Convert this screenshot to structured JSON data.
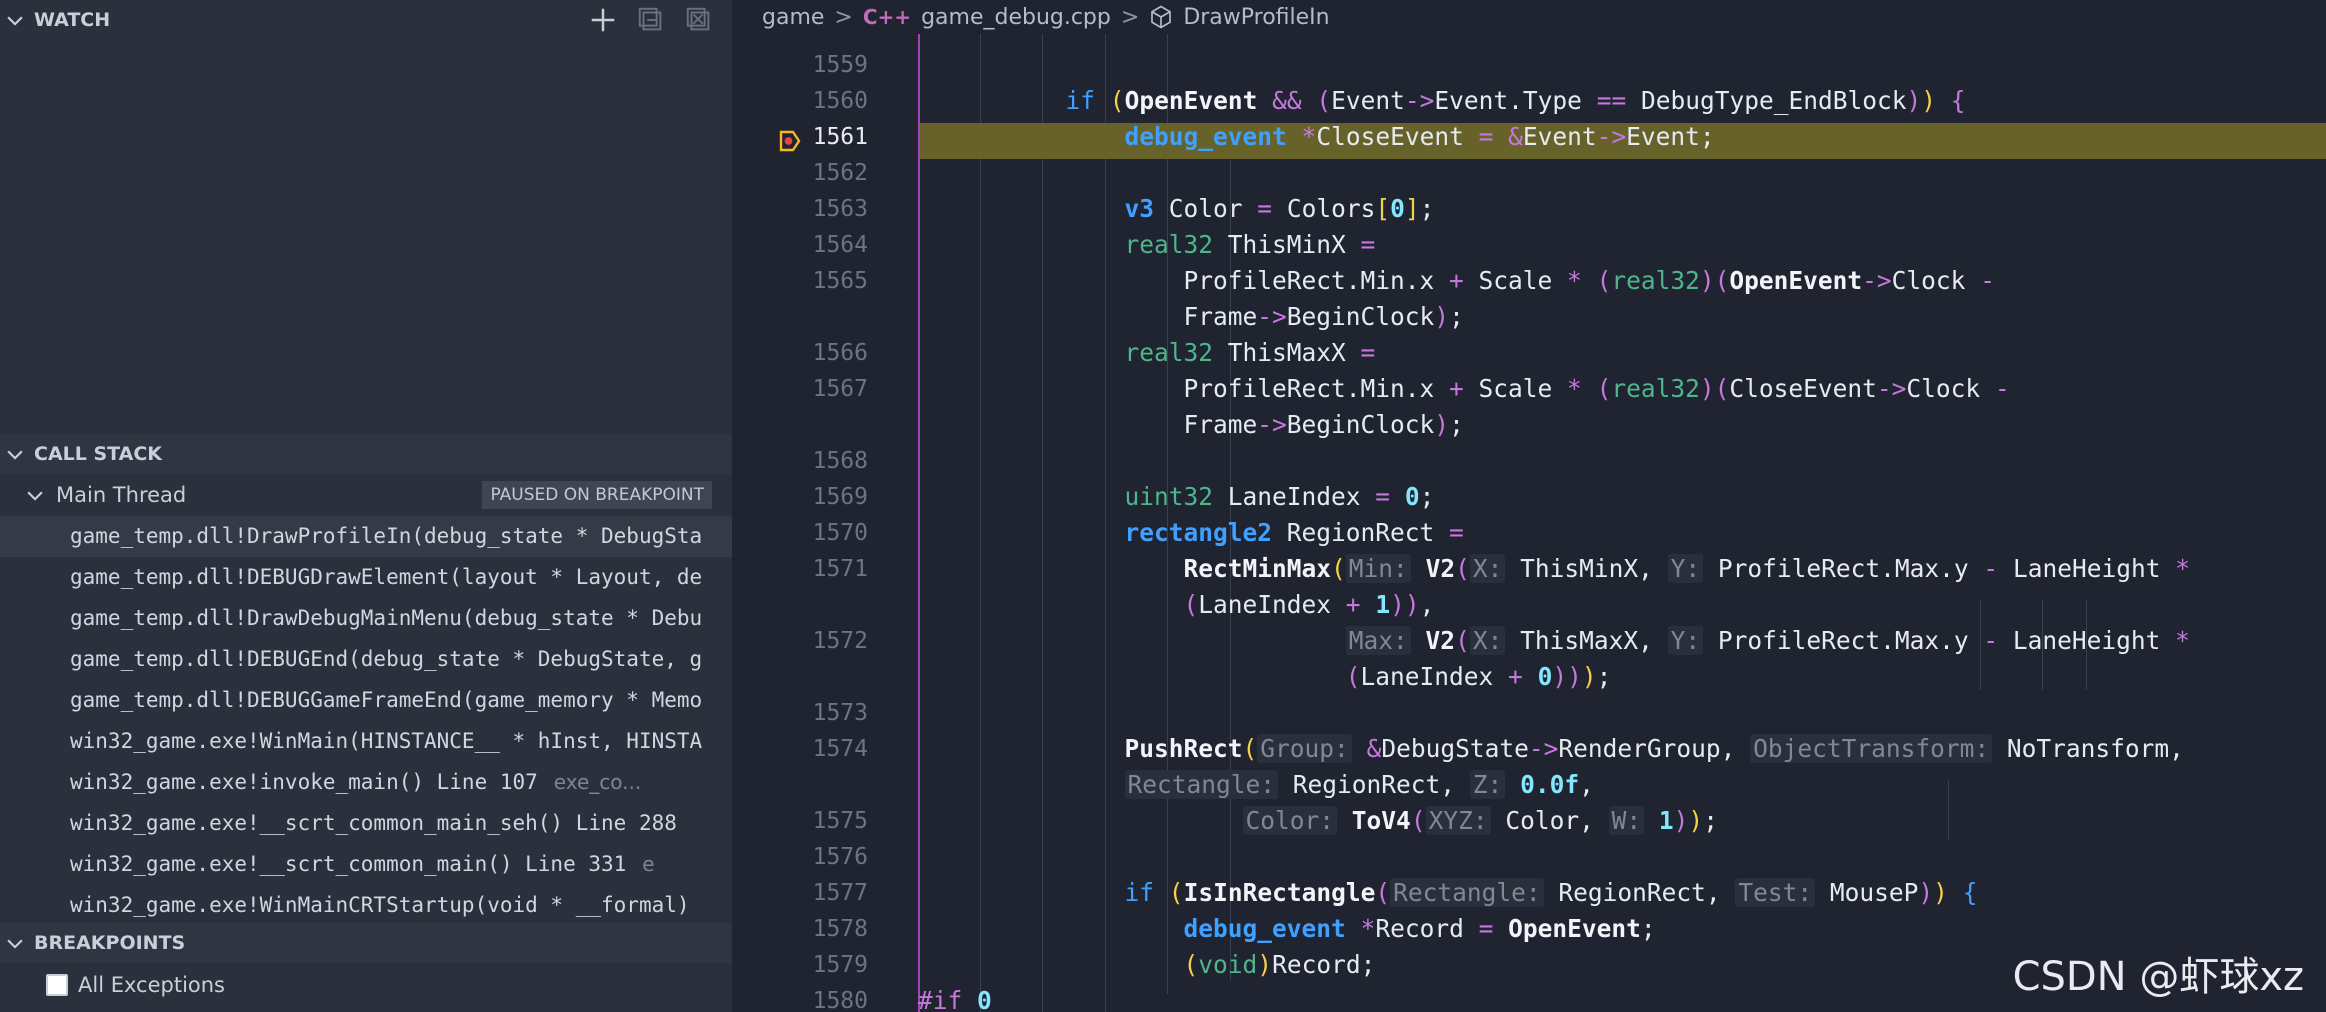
{
  "sidebar": {
    "watch": {
      "title": "WATCH"
    },
    "call_stack": {
      "title": "CALL STACK",
      "thread": "Main Thread",
      "badge": "PAUSED ON BREAKPOINT",
      "frames": [
        {
          "text": "game_temp.dll!DrawProfileIn(debug_state * DebugSta",
          "src": ""
        },
        {
          "text": "game_temp.dll!DEBUGDrawElement(layout * Layout, de",
          "src": ""
        },
        {
          "text": "game_temp.dll!DrawDebugMainMenu(debug_state * Debu",
          "src": ""
        },
        {
          "text": "game_temp.dll!DEBUGEnd(debug_state * DebugState, g",
          "src": ""
        },
        {
          "text": "game_temp.dll!DEBUGGameFrameEnd(game_memory * Memo",
          "src": ""
        },
        {
          "text": "win32_game.exe!WinMain(HINSTANCE__ * hInst, HINSTA",
          "src": ""
        },
        {
          "text": "win32_game.exe!invoke_main() Line 107",
          "src": "exe_co..."
        },
        {
          "text": "win32_game.exe!__scrt_common_main_seh() Line 288",
          "src": ""
        },
        {
          "text": "win32_game.exe!__scrt_common_main() Line 331",
          "src": "e"
        },
        {
          "text": "win32_game.exe!WinMainCRTStartup(void * __formal)",
          "src": ""
        }
      ]
    },
    "breakpoints": {
      "title": "BREAKPOINTS",
      "all_exceptions": "All Exceptions"
    }
  },
  "breadcrumb": {
    "folder": "game",
    "file": "game_debug.cpp",
    "symbol": "DrawProfileIn",
    "sep": ">",
    "cpp_glyph": "C++"
  },
  "editor": {
    "current_line": "1561",
    "line_numbers": [
      "1559",
      "1560",
      "1561",
      "1562",
      "1563",
      "1564",
      "1565",
      "1566",
      "1567",
      "1568",
      "1569",
      "1570",
      "1571",
      "1572",
      "1573",
      "1574",
      "1575",
      "1576",
      "1577",
      "1578",
      "1579",
      "1580"
    ]
  },
  "watermark": "CSDN @虾球xz",
  "colors": {
    "keyword": "#3fa0ff",
    "type": "#4fb58a",
    "operator": "#c678dd",
    "breakpoint_line": "#66622a",
    "breakpoint_marker": "#f5b820"
  }
}
